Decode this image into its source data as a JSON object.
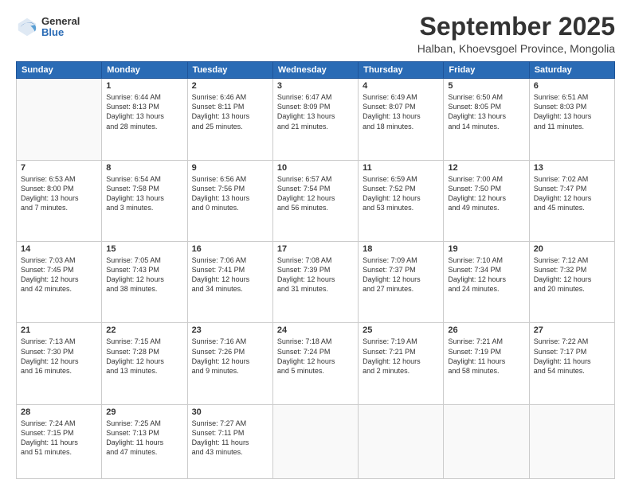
{
  "logo": {
    "general": "General",
    "blue": "Blue"
  },
  "title": "September 2025",
  "subtitle": "Halban, Khoevsgoel Province, Mongolia",
  "days": [
    "Sunday",
    "Monday",
    "Tuesday",
    "Wednesday",
    "Thursday",
    "Friday",
    "Saturday"
  ],
  "weeks": [
    [
      {
        "day": "",
        "info": ""
      },
      {
        "day": "1",
        "info": "Sunrise: 6:44 AM\nSunset: 8:13 PM\nDaylight: 13 hours\nand 28 minutes."
      },
      {
        "day": "2",
        "info": "Sunrise: 6:46 AM\nSunset: 8:11 PM\nDaylight: 13 hours\nand 25 minutes."
      },
      {
        "day": "3",
        "info": "Sunrise: 6:47 AM\nSunset: 8:09 PM\nDaylight: 13 hours\nand 21 minutes."
      },
      {
        "day": "4",
        "info": "Sunrise: 6:49 AM\nSunset: 8:07 PM\nDaylight: 13 hours\nand 18 minutes."
      },
      {
        "day": "5",
        "info": "Sunrise: 6:50 AM\nSunset: 8:05 PM\nDaylight: 13 hours\nand 14 minutes."
      },
      {
        "day": "6",
        "info": "Sunrise: 6:51 AM\nSunset: 8:03 PM\nDaylight: 13 hours\nand 11 minutes."
      }
    ],
    [
      {
        "day": "7",
        "info": "Sunrise: 6:53 AM\nSunset: 8:00 PM\nDaylight: 13 hours\nand 7 minutes."
      },
      {
        "day": "8",
        "info": "Sunrise: 6:54 AM\nSunset: 7:58 PM\nDaylight: 13 hours\nand 3 minutes."
      },
      {
        "day": "9",
        "info": "Sunrise: 6:56 AM\nSunset: 7:56 PM\nDaylight: 13 hours\nand 0 minutes."
      },
      {
        "day": "10",
        "info": "Sunrise: 6:57 AM\nSunset: 7:54 PM\nDaylight: 12 hours\nand 56 minutes."
      },
      {
        "day": "11",
        "info": "Sunrise: 6:59 AM\nSunset: 7:52 PM\nDaylight: 12 hours\nand 53 minutes."
      },
      {
        "day": "12",
        "info": "Sunrise: 7:00 AM\nSunset: 7:50 PM\nDaylight: 12 hours\nand 49 minutes."
      },
      {
        "day": "13",
        "info": "Sunrise: 7:02 AM\nSunset: 7:47 PM\nDaylight: 12 hours\nand 45 minutes."
      }
    ],
    [
      {
        "day": "14",
        "info": "Sunrise: 7:03 AM\nSunset: 7:45 PM\nDaylight: 12 hours\nand 42 minutes."
      },
      {
        "day": "15",
        "info": "Sunrise: 7:05 AM\nSunset: 7:43 PM\nDaylight: 12 hours\nand 38 minutes."
      },
      {
        "day": "16",
        "info": "Sunrise: 7:06 AM\nSunset: 7:41 PM\nDaylight: 12 hours\nand 34 minutes."
      },
      {
        "day": "17",
        "info": "Sunrise: 7:08 AM\nSunset: 7:39 PM\nDaylight: 12 hours\nand 31 minutes."
      },
      {
        "day": "18",
        "info": "Sunrise: 7:09 AM\nSunset: 7:37 PM\nDaylight: 12 hours\nand 27 minutes."
      },
      {
        "day": "19",
        "info": "Sunrise: 7:10 AM\nSunset: 7:34 PM\nDaylight: 12 hours\nand 24 minutes."
      },
      {
        "day": "20",
        "info": "Sunrise: 7:12 AM\nSunset: 7:32 PM\nDaylight: 12 hours\nand 20 minutes."
      }
    ],
    [
      {
        "day": "21",
        "info": "Sunrise: 7:13 AM\nSunset: 7:30 PM\nDaylight: 12 hours\nand 16 minutes."
      },
      {
        "day": "22",
        "info": "Sunrise: 7:15 AM\nSunset: 7:28 PM\nDaylight: 12 hours\nand 13 minutes."
      },
      {
        "day": "23",
        "info": "Sunrise: 7:16 AM\nSunset: 7:26 PM\nDaylight: 12 hours\nand 9 minutes."
      },
      {
        "day": "24",
        "info": "Sunrise: 7:18 AM\nSunset: 7:24 PM\nDaylight: 12 hours\nand 5 minutes."
      },
      {
        "day": "25",
        "info": "Sunrise: 7:19 AM\nSunset: 7:21 PM\nDaylight: 12 hours\nand 2 minutes."
      },
      {
        "day": "26",
        "info": "Sunrise: 7:21 AM\nSunset: 7:19 PM\nDaylight: 11 hours\nand 58 minutes."
      },
      {
        "day": "27",
        "info": "Sunrise: 7:22 AM\nSunset: 7:17 PM\nDaylight: 11 hours\nand 54 minutes."
      }
    ],
    [
      {
        "day": "28",
        "info": "Sunrise: 7:24 AM\nSunset: 7:15 PM\nDaylight: 11 hours\nand 51 minutes."
      },
      {
        "day": "29",
        "info": "Sunrise: 7:25 AM\nSunset: 7:13 PM\nDaylight: 11 hours\nand 47 minutes."
      },
      {
        "day": "30",
        "info": "Sunrise: 7:27 AM\nSunset: 7:11 PM\nDaylight: 11 hours\nand 43 minutes."
      },
      {
        "day": "",
        "info": ""
      },
      {
        "day": "",
        "info": ""
      },
      {
        "day": "",
        "info": ""
      },
      {
        "day": "",
        "info": ""
      }
    ]
  ]
}
